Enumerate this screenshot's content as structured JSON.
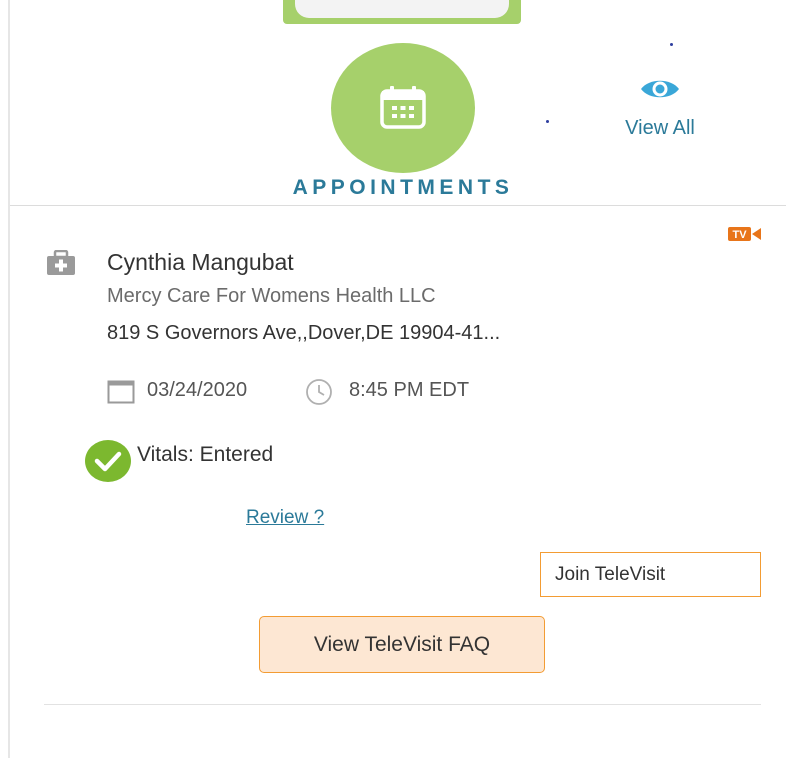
{
  "header": {
    "title": "APPOINTMENTS",
    "view_all_label": "View All",
    "accent_green": "#a6d06b",
    "accent_blue": "#2b7a99"
  },
  "appointment": {
    "badge": "TV",
    "provider_name": "Cynthia Mangubat",
    "clinic": "Mercy Care For Womens Health LLC",
    "address": "819 S Governors Ave,,Dover,DE 19904-41...",
    "date": "03/24/2020",
    "time": "8:45 PM EDT",
    "vitals_status": "Vitals: Entered",
    "review_link": "Review ?",
    "join_button": "Join TeleVisit",
    "faq_button": "View TeleVisit FAQ",
    "accent_orange": "#f39c33"
  },
  "icons": [
    "calendar-icon",
    "eye-icon",
    "televisit-icon",
    "medical-bag-icon",
    "date-icon",
    "clock-icon",
    "check-circle-icon"
  ]
}
